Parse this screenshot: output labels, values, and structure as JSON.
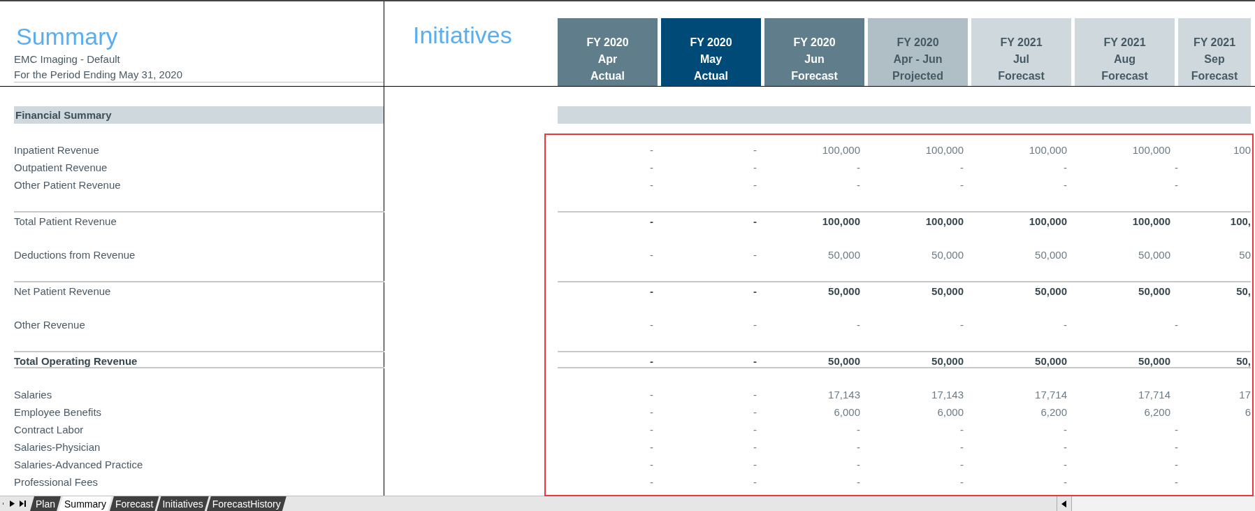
{
  "header": {
    "title": "Summary",
    "entity": "EMC Imaging - Default",
    "period": "For the Period Ending May 31, 2020",
    "initiatives_title": "Initiatives"
  },
  "columns": [
    {
      "year": "FY 2020",
      "period": "Apr",
      "type": "Actual",
      "kind": "actual"
    },
    {
      "year": "FY 2020",
      "period": "May",
      "type": "Actual",
      "kind": "current"
    },
    {
      "year": "FY 2020",
      "period": "Jun",
      "type": "Forecast",
      "kind": "forecast"
    },
    {
      "year": "FY 2020",
      "period": "Apr - Jun",
      "type": "Projected",
      "kind": "projected"
    },
    {
      "year": "FY 2021",
      "period": "Jul",
      "type": "Forecast",
      "kind": "future"
    },
    {
      "year": "FY 2021",
      "period": "Aug",
      "type": "Forecast",
      "kind": "future"
    },
    {
      "year": "FY 2021",
      "period": "Sep",
      "type": "Forecast",
      "kind": "future"
    }
  ],
  "rows": [
    {
      "label": "Financial Summary",
      "kind": "section",
      "space_before": false,
      "values": []
    },
    {
      "label": "Inpatient Revenue",
      "kind": "detail",
      "space_before": true,
      "values": [
        "-",
        "-",
        "100,000",
        "100,000",
        "100,000",
        "100,000",
        "100"
      ]
    },
    {
      "label": "Outpatient Revenue",
      "kind": "detail",
      "space_before": false,
      "values": [
        "-",
        "-",
        "-",
        "-",
        "-",
        "-"
      ]
    },
    {
      "label": "Other Patient Revenue",
      "kind": "detail",
      "space_before": false,
      "values": [
        "-",
        "-",
        "-",
        "-",
        "-",
        "-"
      ]
    },
    {
      "label": "Total Patient Revenue",
      "kind": "subtotal",
      "space_before": true,
      "values": [
        "-",
        "-",
        "100,000",
        "100,000",
        "100,000",
        "100,000",
        "100,"
      ]
    },
    {
      "label": "Deductions from Revenue",
      "kind": "detail",
      "space_before": true,
      "values": [
        "-",
        "-",
        "50,000",
        "50,000",
        "50,000",
        "50,000",
        "50"
      ]
    },
    {
      "label": "Net Patient Revenue",
      "kind": "subtotal",
      "space_before": true,
      "values": [
        "-",
        "-",
        "50,000",
        "50,000",
        "50,000",
        "50,000",
        "50,"
      ]
    },
    {
      "label": "Other Revenue",
      "kind": "detail",
      "space_before": true,
      "values": [
        "-",
        "-",
        "-",
        "-",
        "-",
        "-"
      ]
    },
    {
      "label": "Total Operating Revenue",
      "kind": "total",
      "space_before": true,
      "values": [
        "-",
        "-",
        "50,000",
        "50,000",
        "50,000",
        "50,000",
        "50,"
      ]
    },
    {
      "label": "Salaries",
      "kind": "detail",
      "space_before": true,
      "values": [
        "-",
        "-",
        "17,143",
        "17,143",
        "17,714",
        "17,714",
        "17"
      ]
    },
    {
      "label": "Employee Benefits",
      "kind": "detail",
      "space_before": false,
      "values": [
        "-",
        "-",
        "6,000",
        "6,000",
        "6,200",
        "6,200",
        "6"
      ]
    },
    {
      "label": "Contract Labor",
      "kind": "detail",
      "space_before": false,
      "values": [
        "-",
        "-",
        "-",
        "-",
        "-",
        "-"
      ]
    },
    {
      "label": "Salaries-Physician",
      "kind": "detail",
      "space_before": false,
      "values": [
        "-",
        "-",
        "-",
        "-",
        "-",
        "-"
      ]
    },
    {
      "label": "Salaries-Advanced Practice",
      "kind": "detail",
      "space_before": false,
      "values": [
        "-",
        "-",
        "-",
        "-",
        "-",
        "-"
      ]
    },
    {
      "label": "Professional Fees",
      "kind": "detail",
      "space_before": false,
      "values": [
        "-",
        "-",
        "-",
        "-",
        "-",
        "-"
      ]
    }
  ],
  "sheet_tabs": [
    {
      "label": "Plan",
      "selected": false
    },
    {
      "label": "Summary",
      "selected": true
    },
    {
      "label": "Forecast",
      "selected": false
    },
    {
      "label": "Initiatives",
      "selected": false
    },
    {
      "label": "ForecastHistory",
      "selected": false
    }
  ]
}
